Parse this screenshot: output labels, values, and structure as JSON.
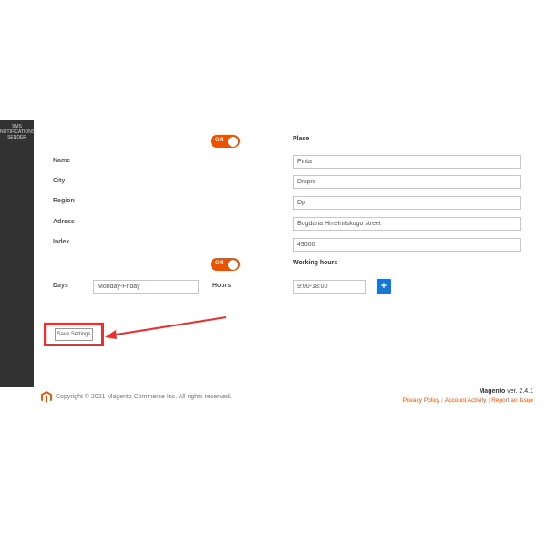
{
  "sidebar": {
    "label": "SMS NOTIFICATIONS SENDER"
  },
  "toggles": {
    "on_label": "ON"
  },
  "section_place": "Place",
  "labels": {
    "name": "Name",
    "city": "City",
    "region": "Region",
    "adress": "Adress",
    "index": "Index",
    "days": "Days",
    "hours": "Hours"
  },
  "fields": {
    "name": "Pinta",
    "city": "Dnipro",
    "region": "Dp",
    "adress": "Bogdana Hmelnitskogo street",
    "index": "49000",
    "days": "Monday-Friday",
    "hours": "9:00-18:00"
  },
  "section_hours": "Working hours",
  "plus_label": "+",
  "save": "Save Settings",
  "footer": {
    "copyright": "Copyright © 2021 Magento Commerce Inc. All rights reserved.",
    "product": "Magento",
    "ver": "ver. 2.4.1",
    "links": {
      "privacy": "Privacy Policy",
      "activity": "Account Activity",
      "report": "Report an Issue"
    }
  }
}
